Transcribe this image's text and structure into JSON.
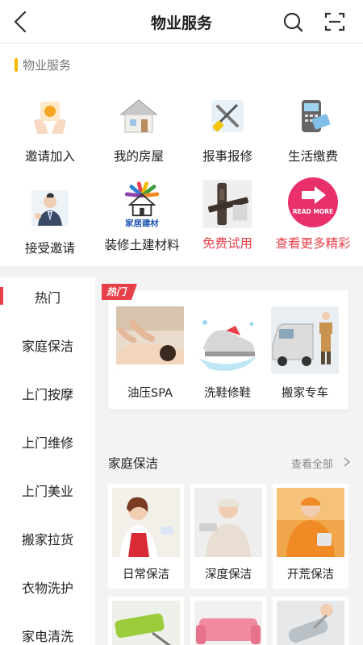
{
  "header": {
    "title": "物业服务"
  },
  "section": {
    "label": "物业服务"
  },
  "grid": [
    {
      "label": "邀请加入",
      "icon": "invite-hands-icon"
    },
    {
      "label": "我的房屋",
      "icon": "house-icon"
    },
    {
      "label": "报事报修",
      "icon": "repair-tools-icon"
    },
    {
      "label": "生活缴费",
      "icon": "card-payment-icon"
    },
    {
      "label": "接受邀请",
      "icon": "accept-person-icon"
    },
    {
      "label": "装修土建材料",
      "icon": "home-materials-icon",
      "icon_text": "家居建材"
    },
    {
      "label": "免费试用",
      "icon": "smart-lock-icon"
    },
    {
      "label": "查看更多精彩",
      "icon": "read-more-icon",
      "icon_text": "READ MORE"
    }
  ],
  "colors": {
    "accent": "#e8404b",
    "section_bar": "#f5b800",
    "pane_bg": "#f3f3f3"
  },
  "sidebar": {
    "items": [
      {
        "label": "热门"
      },
      {
        "label": "家庭保洁"
      },
      {
        "label": "上门按摩"
      },
      {
        "label": "上门维修"
      },
      {
        "label": "上门美业"
      },
      {
        "label": "搬家拉货"
      },
      {
        "label": "衣物洗护"
      },
      {
        "label": "家电清洗"
      }
    ]
  },
  "hot": {
    "tag": "热门",
    "items": [
      {
        "label": "油压SPA",
        "icon": "spa-massage-image"
      },
      {
        "label": "洗鞋修鞋",
        "icon": "shoe-wash-image"
      },
      {
        "label": "搬家专车",
        "icon": "moving-van-image"
      }
    ]
  },
  "cleaning": {
    "title": "家庭保洁",
    "more": "查看全部",
    "items": [
      {
        "label": "日常保洁",
        "icon": "daily-cleaning-image"
      },
      {
        "label": "深度保洁",
        "icon": "deep-cleaning-image"
      },
      {
        "label": "开荒保洁",
        "icon": "reclamation-cleaning-image"
      }
    ],
    "next_row": [
      {
        "icon": "green-mop-image"
      },
      {
        "icon": "pink-sofa-image"
      },
      {
        "icon": "vacuum-image"
      }
    ]
  }
}
